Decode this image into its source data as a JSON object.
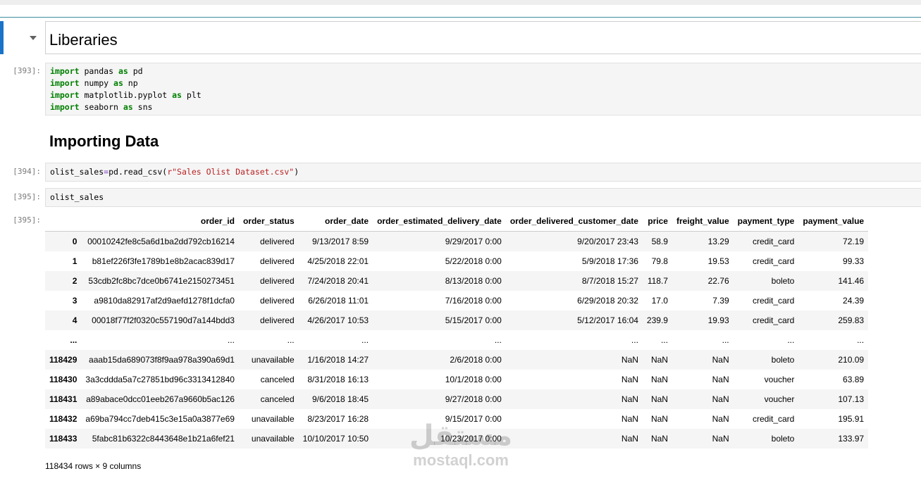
{
  "cells": {
    "libraries": {
      "heading": "Liberaries"
    },
    "imports": {
      "prompt": "[393]:",
      "lines": [
        {
          "kw1": "import",
          "mod": " pandas ",
          "kw2": "as",
          "alias": " pd"
        },
        {
          "kw1": "import",
          "mod": " numpy ",
          "kw2": "as",
          "alias": " np"
        },
        {
          "kw1": "import",
          "mod": " matplotlib.pyplot ",
          "kw2": "as",
          "alias": " plt"
        },
        {
          "kw1": "import",
          "mod": " seaborn ",
          "kw2": "as",
          "alias": " sns"
        }
      ]
    },
    "importing": {
      "heading": "Importing Data"
    },
    "read_csv": {
      "prompt": "[394]:",
      "var": "olist_sales",
      "op": "=",
      "call": "pd.read_csv(",
      "string": "r\"Sales Olist Dataset.csv\"",
      "close": ")"
    },
    "show_df": {
      "prompt": "[395]:",
      "code": "olist_sales"
    },
    "output": {
      "prompt": "[395]:"
    }
  },
  "dataframe": {
    "columns": [
      "",
      "order_id",
      "order_status",
      "order_date",
      "order_estimated_delivery_date",
      "order_delivered_customer_date",
      "price",
      "freight_value",
      "payment_type",
      "payment_value"
    ],
    "rows": [
      [
        "0",
        "00010242fe8c5a6d1ba2dd792cb16214",
        "delivered",
        "9/13/2017 8:59",
        "9/29/2017 0:00",
        "9/20/2017 23:43",
        "58.9",
        "13.29",
        "credit_card",
        "72.19"
      ],
      [
        "1",
        "b81ef226f3fe1789b1e8b2acac839d17",
        "delivered",
        "4/25/2018 22:01",
        "5/22/2018 0:00",
        "5/9/2018 17:36",
        "79.8",
        "19.53",
        "credit_card",
        "99.33"
      ],
      [
        "2",
        "53cdb2fc8bc7dce0b6741e2150273451",
        "delivered",
        "7/24/2018 20:41",
        "8/13/2018 0:00",
        "8/7/2018 15:27",
        "118.7",
        "22.76",
        "boleto",
        "141.46"
      ],
      [
        "3",
        "a9810da82917af2d9aefd1278f1dcfa0",
        "delivered",
        "6/26/2018 11:01",
        "7/16/2018 0:00",
        "6/29/2018 20:32",
        "17.0",
        "7.39",
        "credit_card",
        "24.39"
      ],
      [
        "4",
        "00018f77f2f0320c557190d7a144bdd3",
        "delivered",
        "4/26/2017 10:53",
        "5/15/2017 0:00",
        "5/12/2017 16:04",
        "239.9",
        "19.93",
        "credit_card",
        "259.83"
      ],
      [
        "...",
        "...",
        "...",
        "...",
        "...",
        "...",
        "...",
        "...",
        "...",
        "..."
      ],
      [
        "118429",
        "aaab15da689073f8f9aa978a390a69d1",
        "unavailable",
        "1/16/2018 14:27",
        "2/6/2018 0:00",
        "NaN",
        "NaN",
        "NaN",
        "boleto",
        "210.09"
      ],
      [
        "118430",
        "3a3cddda5a7c27851bd96c3313412840",
        "canceled",
        "8/31/2018 16:13",
        "10/1/2018 0:00",
        "NaN",
        "NaN",
        "NaN",
        "voucher",
        "63.89"
      ],
      [
        "118431",
        "a89abace0dcc01eeb267a9660b5ac126",
        "canceled",
        "9/6/2018 18:45",
        "9/27/2018 0:00",
        "NaN",
        "NaN",
        "NaN",
        "voucher",
        "107.13"
      ],
      [
        "118432",
        "a69ba794cc7deb415c3e15a0a3877e69",
        "unavailable",
        "8/23/2017 16:28",
        "9/15/2017 0:00",
        "NaN",
        "NaN",
        "NaN",
        "credit_card",
        "195.91"
      ],
      [
        "118433",
        "5fabc81b6322c8443648e1b21a6fef21",
        "unavailable",
        "10/10/2017 10:50",
        "10/23/2017 0:00",
        "NaN",
        "NaN",
        "NaN",
        "boleto",
        "133.97"
      ]
    ],
    "shape_text": "118434 rows × 9 columns"
  },
  "watermark": {
    "arabic": "مستقل",
    "latin": "mostaql.com"
  }
}
